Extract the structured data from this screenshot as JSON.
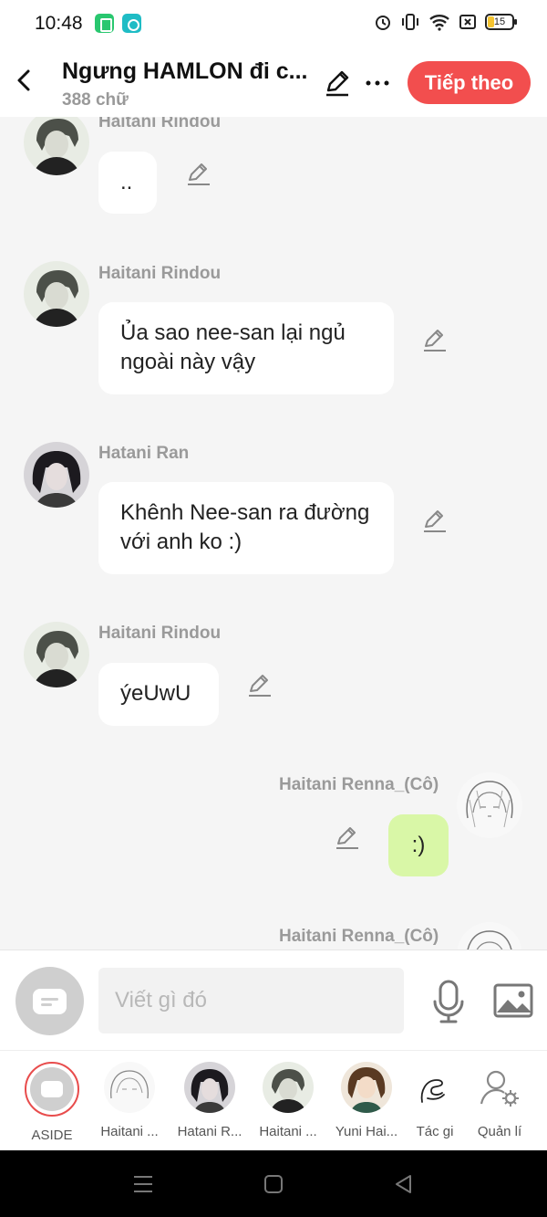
{
  "status": {
    "time": "10:48",
    "battery": "15"
  },
  "header": {
    "back_icon": "chevron-left-icon",
    "title": "Ngưng HAMLON đi c...",
    "subtitle": "388 chữ",
    "next_label": "Tiếp theo"
  },
  "messages": [
    {
      "sender": "Haitani Rindou",
      "text": ".."
    },
    {
      "sender": "Haitani Rindou",
      "text": "Ủa sao nee-san lại ngủ ngoài này vậy"
    },
    {
      "sender": "Hatani Ran",
      "text": "Khênh Nee-san ra đường với anh ko :)"
    },
    {
      "sender": "Haitani Rindou",
      "text": "ýeUwU"
    },
    {
      "sender": "Haitani Renna_(Cô)",
      "text": ":)"
    },
    {
      "sender": "Haitani Renna_(Cô)",
      "text": ""
    }
  ],
  "composer": {
    "placeholder": "Viết gì đó"
  },
  "characters": [
    {
      "label": "ASIDE"
    },
    {
      "label": "Haitani ..."
    },
    {
      "label": "Hatani R..."
    },
    {
      "label": "Haitani ..."
    },
    {
      "label": "Yuni Hai..."
    },
    {
      "label": "Tác gi"
    },
    {
      "label": "Quản lí"
    }
  ],
  "colors": {
    "accent": "#f24e4e",
    "mine_bubble": "#d9f7a7",
    "background": "#f5f5f5"
  }
}
